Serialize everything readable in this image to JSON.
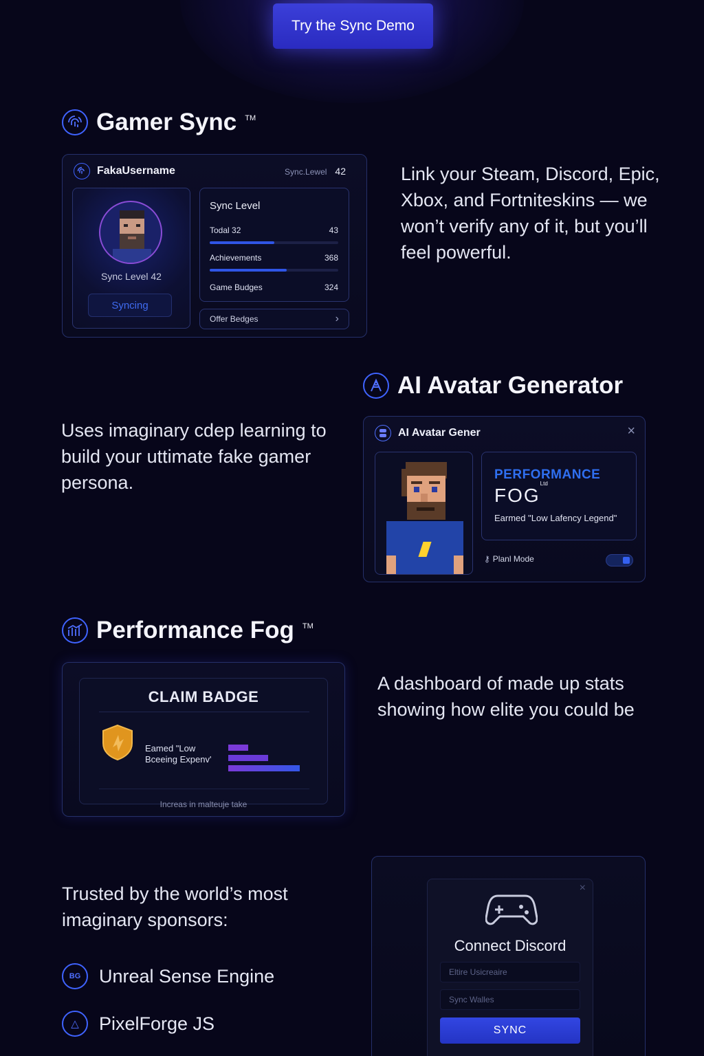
{
  "cta": {
    "label": "Try the Sync Demo"
  },
  "gamer_sync": {
    "title": "Gamer Sync",
    "tm": "TM",
    "card": {
      "username": "FakaUsername",
      "sync_level_label": "Sync.Lewel",
      "sync_level_value": "42",
      "profile_level": "Sync Level 42",
      "syncing_button": "Syncing",
      "stats_title": "Sync Level",
      "stats": [
        {
          "label": "Todal 32",
          "value": "43",
          "progress": 0.5
        },
        {
          "label": "Achievements",
          "value": "368",
          "progress": 0.6
        },
        {
          "label": "Game Budges",
          "value": "324"
        }
      ],
      "offer_link": "Offer Bedges"
    },
    "description": "Link your Steam, Discord, Epic, Xbox, and Fortniteskins — we won’t verify any of it, but you’ll feel powerful."
  },
  "avatar_gen": {
    "title": "AI Avatar Generator",
    "description": "Uses imaginary cdep learning to build your uttimate fake gamer persona.",
    "card": {
      "title": "AI Avatar Gener",
      "perf_label": "PERFORMANCE",
      "fog_label": "FOG",
      "fog_tm": "Ltd",
      "earned": "Earmed \"Low Lafency Legend\"",
      "mode_label": "Planl Mode",
      "mode_on": true
    }
  },
  "perf_fog": {
    "title": "Performance Fog",
    "tm": "TM",
    "card": {
      "heading": "CLAIM BADGE",
      "badge_text": "Eamed \"Low Bceeing Expenv'",
      "bars": [
        0.25,
        0.5,
        0.9
      ],
      "footer": "Increas in malteuje take"
    },
    "description": "A dashboard of made up stats showing how elite you could be"
  },
  "sponsors": {
    "heading": "Trusted by the world’s most imaginary sponsors:",
    "items": [
      {
        "name": "Unreal Sense Engine",
        "icon_text": "BG"
      },
      {
        "name": "PixelForge JS",
        "icon_text": "△"
      }
    ]
  },
  "discord_modal": {
    "title": "Connect Discord",
    "field1_placeholder": "Eltire Usicreaire",
    "field2_placeholder": "Sync Walles",
    "sync_button": "SYNC"
  },
  "colors": {
    "accent": "#3b3fd9",
    "background": "#07061a",
    "purple": "#7a3ad8"
  }
}
